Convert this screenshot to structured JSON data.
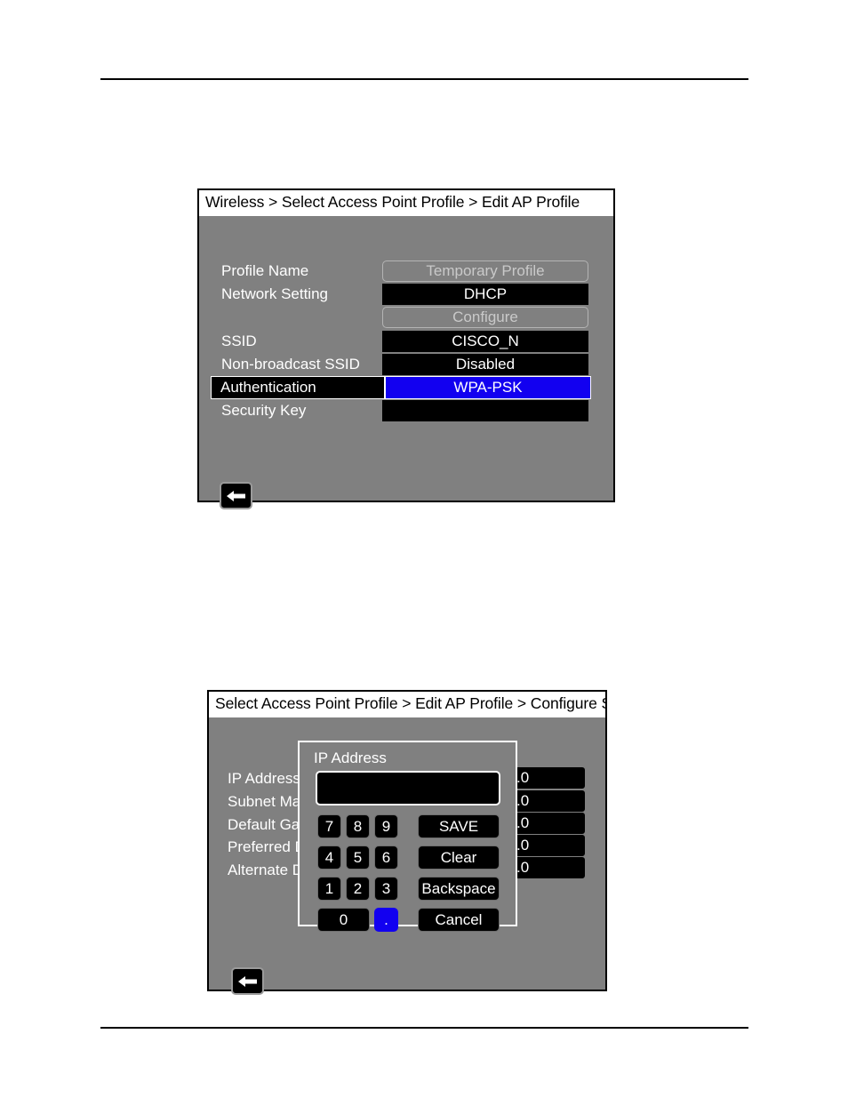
{
  "page": {
    "background": "#ffffff",
    "rule_color": "#000000"
  },
  "colors": {
    "panel_bg": "#808080",
    "field_bg": "#000000",
    "field_text": "#ffffff",
    "accent_selected": "#1200f0",
    "disabled_text": "#c9c9c9",
    "titlebar_bg": "#ffffff"
  },
  "panel1": {
    "titlebar": "Wireless > Select Access Point Profile > Edit AP Profile",
    "rows": [
      {
        "label": "Profile Name",
        "value": "Temporary Profile",
        "style": "disabled"
      },
      {
        "label": "Network Setting",
        "value": "DHCP",
        "style": "dark"
      },
      {
        "label": "",
        "value": "Configure",
        "style": "disabled"
      },
      {
        "label": "SSID",
        "value": "CISCO_N",
        "style": "dark"
      },
      {
        "label": "Non-broadcast SSID",
        "value": "Disabled",
        "style": "dark"
      },
      {
        "label": "Authentication",
        "value": "WPA-PSK",
        "style": "selected",
        "label_focused": true
      },
      {
        "label": "Security Key",
        "value": "",
        "style": "dark"
      }
    ],
    "back_button": {
      "icon": "back-arrow-icon",
      "label": "Back"
    }
  },
  "panel2": {
    "titlebar": "Select Access Point Profile > Edit AP Profile > Configure Stat",
    "rows": [
      {
        "label": "IP Address",
        "value": ".0"
      },
      {
        "label": "Subnet Ma",
        "value": ".0"
      },
      {
        "label": "Default Ga",
        "value": ".0"
      },
      {
        "label": "Preferred D",
        "value": ".0"
      },
      {
        "label": "Alternate D",
        "value": ".0"
      }
    ],
    "dialog": {
      "title": "IP Address",
      "input_value": "",
      "keys": [
        {
          "id": "key-7",
          "label": "7",
          "accent": false
        },
        {
          "id": "key-8",
          "label": "8",
          "accent": false
        },
        {
          "id": "key-9",
          "label": "9",
          "accent": false
        },
        {
          "id": "key-save",
          "label": "SAVE",
          "accent": false
        },
        {
          "id": "key-4",
          "label": "4",
          "accent": false
        },
        {
          "id": "key-5",
          "label": "5",
          "accent": false
        },
        {
          "id": "key-6",
          "label": "6",
          "accent": false
        },
        {
          "id": "key-clear",
          "label": "Clear",
          "accent": false
        },
        {
          "id": "key-1",
          "label": "1",
          "accent": false
        },
        {
          "id": "key-2",
          "label": "2",
          "accent": false
        },
        {
          "id": "key-3",
          "label": "3",
          "accent": false
        },
        {
          "id": "key-backspace",
          "label": "Backspace",
          "accent": false
        },
        {
          "id": "key-0",
          "label": "0",
          "accent": false
        },
        {
          "id": "key-dot",
          "label": ".",
          "accent": true
        },
        {
          "id": "key-cancel",
          "label": "Cancel",
          "accent": false
        }
      ]
    },
    "back_button": {
      "icon": "back-arrow-icon",
      "label": "Back"
    }
  }
}
